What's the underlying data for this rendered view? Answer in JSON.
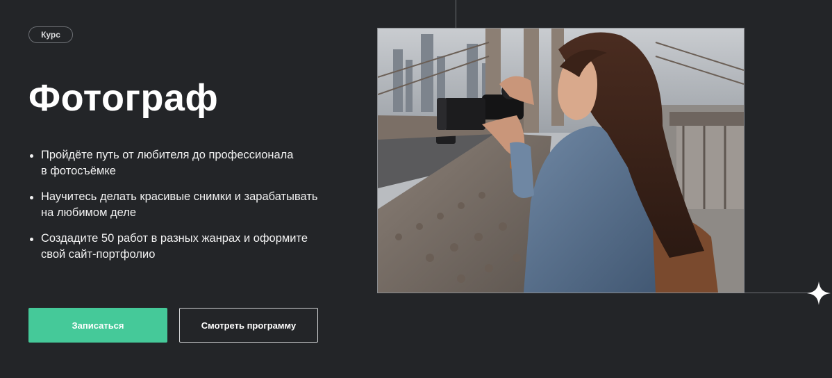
{
  "badge": {
    "label": "Курс"
  },
  "hero": {
    "title": "Фотограф",
    "bullets": [
      {
        "line1": "Пройдёте путь от любителя до профессионала",
        "line2": "в фотосъёмке"
      },
      {
        "line1": "Научитесь делать красивые снимки и зарабатывать",
        "line2": "на любимом деле"
      },
      {
        "line1": "Создадите 50 работ в разных жанрах и оформите",
        "line2": "свой сайт-портфолио"
      }
    ]
  },
  "buttons": {
    "primary": "Записаться",
    "secondary": "Смотреть программу"
  },
  "colors": {
    "background": "#232528",
    "accent": "#45c999",
    "text": "#ffffff"
  },
  "photo": {
    "subject": "woman-photographer-on-bridge"
  },
  "icons": {
    "sparkle": "four-point-star-icon"
  }
}
